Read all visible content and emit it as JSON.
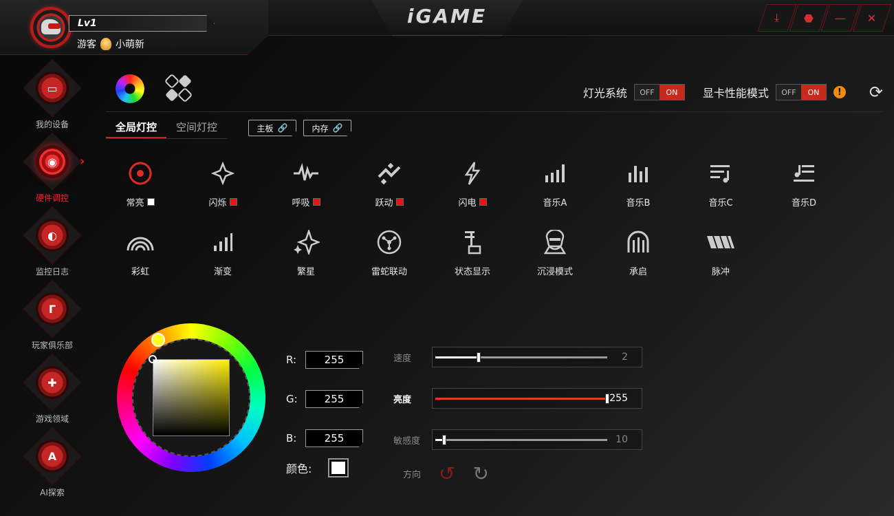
{
  "profile": {
    "level": "Lv1",
    "guest_label": "游客",
    "rank_label": "小萌新"
  },
  "app_title": "iGAME",
  "window_controls": [
    {
      "name": "download-notify-button",
      "glyph": "⤓"
    },
    {
      "name": "skin-button",
      "glyph": "⬣"
    },
    {
      "name": "minimize-button",
      "glyph": "—"
    },
    {
      "name": "close-button",
      "glyph": "✕"
    }
  ],
  "sidebar": {
    "items": [
      {
        "label": "我的设备",
        "icon": "monitor-icon",
        "glyph": "▭",
        "active": false
      },
      {
        "label": "硬件调控",
        "icon": "control-icon",
        "glyph": "◉",
        "active": true
      },
      {
        "label": "监控日志",
        "icon": "gauge-icon",
        "glyph": "◐",
        "active": false
      },
      {
        "label": "玩家俱乐部",
        "icon": "club-icon",
        "glyph": "Γ",
        "active": false
      },
      {
        "label": "游戏领域",
        "icon": "gamepad-icon",
        "glyph": "✚",
        "active": false
      },
      {
        "label": "AI探索",
        "icon": "ai-icon",
        "glyph": "A",
        "active": false
      }
    ]
  },
  "header_toggles": {
    "lighting": {
      "label": "灯光系统",
      "off": "OFF",
      "on": "ON"
    },
    "performance": {
      "label": "显卡性能模式",
      "off": "OFF",
      "on": "ON"
    },
    "warning_glyph": "!"
  },
  "tabs": {
    "global": "全局灯控",
    "spatial": "空间灯控"
  },
  "link_buttons": {
    "motherboard": "主板",
    "memory": "内存"
  },
  "effects": [
    {
      "label": "常亮",
      "icon": "steady-icon",
      "swatch": "#ffffff"
    },
    {
      "label": "闪烁",
      "icon": "flash-icon",
      "swatch": "#ee1111"
    },
    {
      "label": "呼吸",
      "icon": "breath-icon",
      "swatch": "#ee1111"
    },
    {
      "label": "跃动",
      "icon": "jump-icon",
      "swatch": "#ee1111"
    },
    {
      "label": "闪电",
      "icon": "lightning-icon",
      "swatch": "#ee1111"
    },
    {
      "label": "音乐A",
      "icon": "music-a-icon",
      "swatch": ""
    },
    {
      "label": "音乐B",
      "icon": "music-b-icon",
      "swatch": ""
    },
    {
      "label": "音乐C",
      "icon": "music-c-icon",
      "swatch": ""
    },
    {
      "label": "音乐D",
      "icon": "music-d-icon",
      "swatch": ""
    },
    {
      "label": "彩虹",
      "icon": "rainbow-icon",
      "swatch": ""
    },
    {
      "label": "渐变",
      "icon": "gradient-icon",
      "swatch": ""
    },
    {
      "label": "繁星",
      "icon": "stars-icon",
      "swatch": ""
    },
    {
      "label": "雷蛇联动",
      "icon": "razer-sync-icon",
      "swatch": ""
    },
    {
      "label": "状态显示",
      "icon": "status-icon",
      "swatch": ""
    },
    {
      "label": "沉浸模式",
      "icon": "immersive-icon",
      "swatch": ""
    },
    {
      "label": "承启",
      "icon": "transition-icon",
      "swatch": ""
    },
    {
      "label": "脉冲",
      "icon": "pulse-icon",
      "swatch": ""
    }
  ],
  "rgb": {
    "r_label": "R:",
    "g_label": "G:",
    "b_label": "B:",
    "r": "255",
    "g": "255",
    "b": "255",
    "color_label": "颜色:",
    "color_value": "#ffffff"
  },
  "sliders": {
    "speed": {
      "label": "速度",
      "value": "2",
      "level": 0.25
    },
    "brightness": {
      "label": "亮度",
      "value": "255",
      "level": 1.0
    },
    "sensitivity": {
      "label": "敏感度",
      "value": "10",
      "level": 0.05
    }
  },
  "direction": {
    "label": "方向"
  },
  "colors": {
    "accent": "#e0392a",
    "active_nav": "#e82a2a",
    "warning": "#f08a10"
  }
}
